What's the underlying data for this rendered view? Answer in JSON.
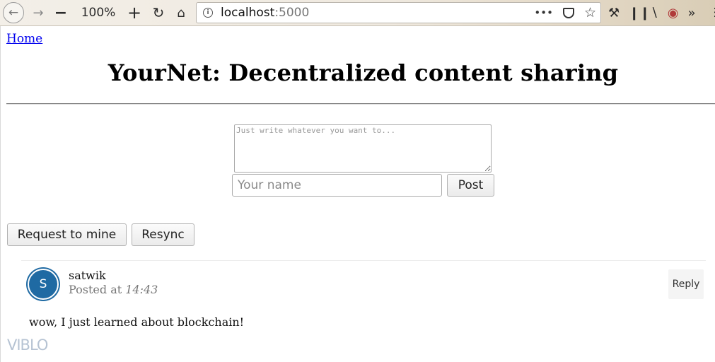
{
  "browser": {
    "zoom": "100%",
    "url_host": "localhost",
    "url_port": ":5000",
    "icons": [
      "back-icon",
      "forward-icon",
      "zoom-out-icon",
      "zoom-in-icon",
      "reload-icon",
      "home-icon",
      "info-icon",
      "page-actions-icon",
      "pocket-icon",
      "bookmark-star-icon",
      "tools-icon",
      "library-icon",
      "extension-icon",
      "overflow-icon",
      "menu-icon"
    ]
  },
  "nav": {
    "home_label": "Home"
  },
  "header": {
    "title": "YourNet: Decentralized content sharing"
  },
  "form": {
    "content_placeholder": "Just write whatever you want to...",
    "name_placeholder": "Your name",
    "post_label": "Post"
  },
  "actions": {
    "request_label": "Request to mine",
    "resync_label": "Resync"
  },
  "posts": [
    {
      "avatar_letter": "S",
      "author": "satwik",
      "posted_prefix": "Posted at",
      "time": "14:43",
      "reply_label": "Reply",
      "content": "wow, I just learned about blockchain!"
    }
  ],
  "watermark": "VIBLO",
  "colors": {
    "avatar": "#1f6aa3",
    "link": "#0000ee",
    "watermark": "#b6c3d3"
  }
}
